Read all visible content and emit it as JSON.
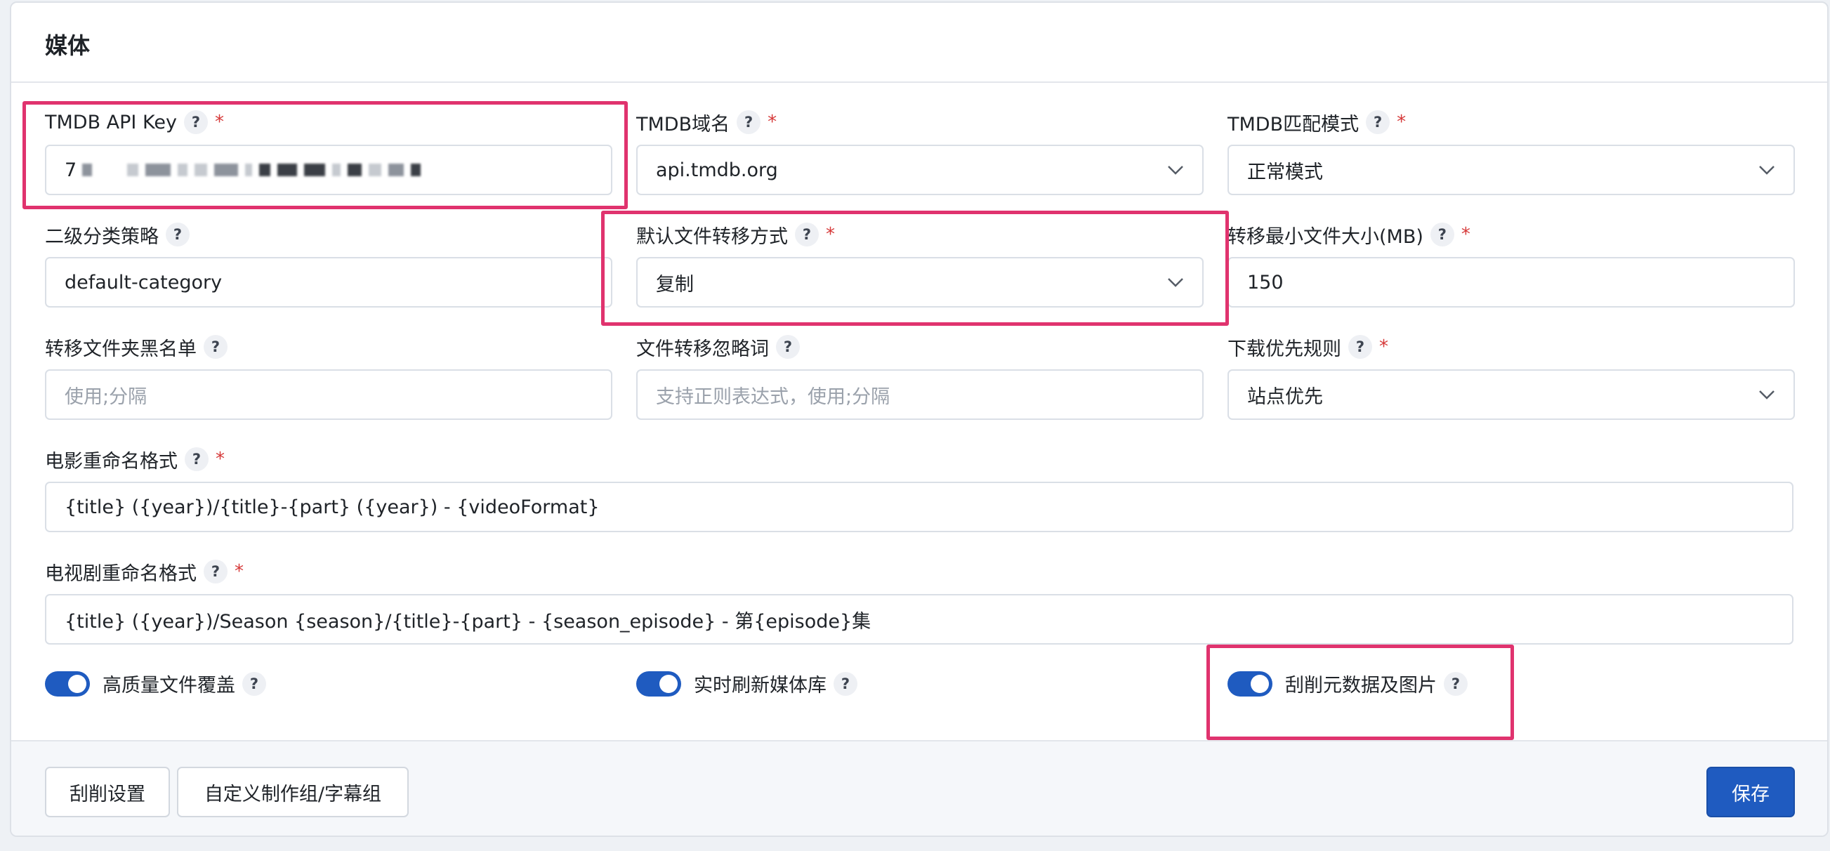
{
  "section": {
    "title": "媒体"
  },
  "fields": {
    "tmdb_api_key": {
      "label": "TMDB API Key",
      "help": "?",
      "required": "*",
      "value_visible": "7"
    },
    "tmdb_domain": {
      "label": "TMDB域名",
      "help": "?",
      "required": "*",
      "value": "api.tmdb.org"
    },
    "tmdb_match_mode": {
      "label": "TMDB匹配模式",
      "help": "?",
      "required": "*",
      "value": "正常模式"
    },
    "secondary_category": {
      "label": "二级分类策略",
      "help": "?",
      "value": "default-category"
    },
    "default_transfer": {
      "label": "默认文件转移方式",
      "help": "?",
      "required": "*",
      "value": "复制"
    },
    "min_file_size": {
      "label": "转移最小文件大小(MB)",
      "help": "?",
      "required": "*",
      "value": "150"
    },
    "folder_blacklist": {
      "label": "转移文件夹黑名单",
      "help": "?",
      "placeholder": "使用;分隔"
    },
    "ignore_words": {
      "label": "文件转移忽略词",
      "help": "?",
      "placeholder": "支持正则表达式，使用;分隔"
    },
    "download_priority": {
      "label": "下载优先规则",
      "help": "?",
      "required": "*",
      "value": "站点优先"
    },
    "movie_rename": {
      "label": "电影重命名格式",
      "help": "?",
      "required": "*",
      "value": "{title} ({year})/{title}-{part} ({year}) - {videoFormat}"
    },
    "tv_rename": {
      "label": "电视剧重命名格式",
      "help": "?",
      "required": "*",
      "value": "{title} ({year})/Season {season}/{title}-{part} - {season_episode} - 第{episode}集"
    }
  },
  "toggles": [
    {
      "label": "高质量文件覆盖",
      "help": "?",
      "on": true
    },
    {
      "label": "实时刷新媒体库",
      "help": "?",
      "on": true
    },
    {
      "label": "刮削元数据及图片",
      "help": "?",
      "on": true
    }
  ],
  "footer": {
    "scrape_settings": "刮削设置",
    "custom_groups": "自定义制作组/字幕组",
    "save": "保存"
  },
  "colors": {
    "accent": "#1f5bc0",
    "highlight": "#e0336e",
    "required": "#d63939"
  }
}
